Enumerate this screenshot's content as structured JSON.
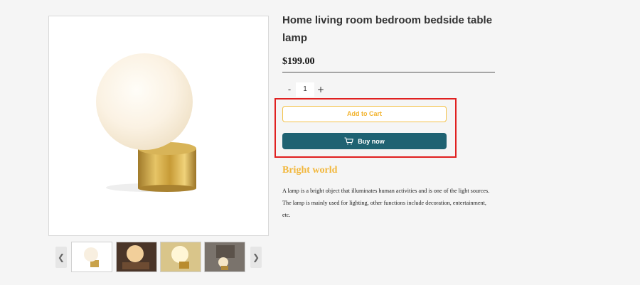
{
  "product": {
    "title": "Home living room bedroom bedside table lamp",
    "price": "$199.00",
    "quantity": "1",
    "qty_minus": "-",
    "qty_plus": "+",
    "add_to_cart_label": "Add to Cart",
    "buy_now_label": "Buy now",
    "subheading": "Bright world",
    "description": "A lamp is a bright object that illuminates human activities and is one of the light sources. The lamp is mainly used for lighting, other functions include decoration, entertainment, etc."
  },
  "gallery": {
    "prev_arrow": "❮",
    "next_arrow": "❯",
    "main_image_icon": "table-lamp-image",
    "thumbnails": [
      "lamp-thumb-white",
      "lamp-thumb-glow",
      "lamp-thumb-gold",
      "lamp-thumb-night"
    ]
  },
  "colors": {
    "accent_gold": "#f2b73b",
    "buy_button": "#1f6272",
    "highlight_red": "#e02020"
  }
}
